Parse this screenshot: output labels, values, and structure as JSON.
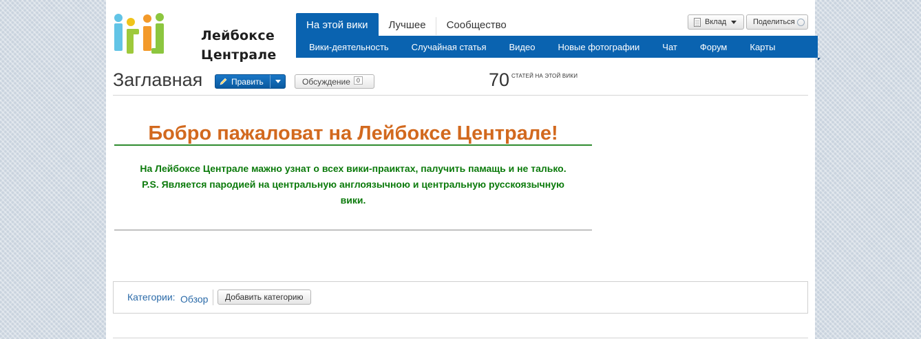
{
  "site": {
    "logo_line1": "Лейбоксе",
    "logo_line2": "Централе"
  },
  "nav": {
    "tabs": [
      {
        "label": "На этой вики",
        "active": true
      },
      {
        "label": "Лучшее"
      },
      {
        "label": "Сообщество"
      }
    ],
    "subnav": [
      "Вики-деятельность",
      "Случайная статья",
      "Видео",
      "Новые фотографии",
      "Чат",
      "Форум",
      "Карты"
    ]
  },
  "toolbar": {
    "contribute_label": "Вклад",
    "share_label": "Поделиться"
  },
  "page": {
    "title": "Заглавная",
    "edit_label": "Править",
    "talk_label": "Обсуждение",
    "talk_count": "0",
    "article_count": "70",
    "article_count_label": "СТАТЕЙ НА ЭТОЙ ВИКИ"
  },
  "content": {
    "welcome_title": "Бобро пажаловат на Лейбоксе Централе!",
    "welcome_lines": [
      "На Лейбоксе Централе мажно узнат о всех вики-праиктах, палучить памащь и не талько.",
      "P.S. Является пародией на центральную англоязычною и центральную русскоязычную",
      "вики."
    ]
  },
  "categories": {
    "label": "Категории:",
    "items": [
      "Обзор"
    ],
    "add_label": "Добавить категорию"
  },
  "colors": {
    "accent": "#0a63b0",
    "welcome_title": "#d2691e",
    "welcome_text": "#0b7a0b",
    "link": "#2a6aa8"
  }
}
